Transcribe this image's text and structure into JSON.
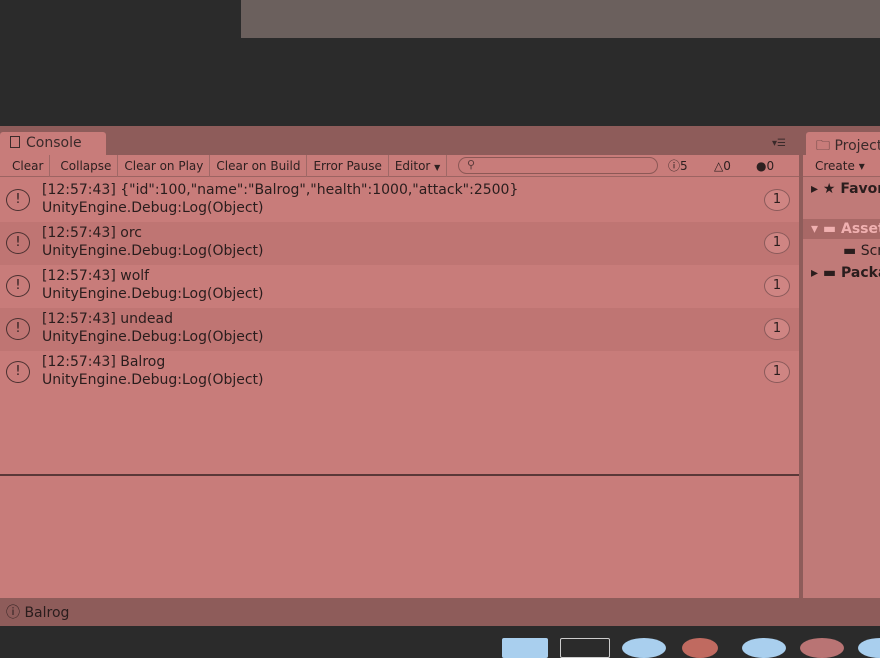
{
  "console": {
    "tab_title": "Console",
    "toolbar": {
      "clear": "Clear",
      "collapse": "Collapse",
      "clear_on_play": "Clear on Play",
      "clear_on_build": "Clear on Build",
      "error_pause": "Error Pause",
      "editor": "Editor"
    },
    "search_placeholder": "",
    "counts": {
      "info": "5",
      "warning": "0",
      "error": "0"
    },
    "entries": [
      {
        "line1": "[12:57:43] {\"id\":100,\"name\":\"Balrog\",\"health\":1000,\"attack\":2500}",
        "line2": "UnityEngine.Debug:Log(Object)",
        "count": "1"
      },
      {
        "line1": "[12:57:43] orc",
        "line2": "UnityEngine.Debug:Log(Object)",
        "count": "1"
      },
      {
        "line1": "[12:57:43] wolf",
        "line2": "UnityEngine.Debug:Log(Object)",
        "count": "1"
      },
      {
        "line1": "[12:57:43] undead",
        "line2": "UnityEngine.Debug:Log(Object)",
        "count": "1"
      },
      {
        "line1": "[12:57:43] Balrog",
        "line2": "UnityEngine.Debug:Log(Object)",
        "count": "1"
      }
    ]
  },
  "project": {
    "tab_title": "Project",
    "create": "Create",
    "items": [
      "Favorites",
      "Assets",
      "Scripts",
      "Packages"
    ]
  },
  "status": {
    "message": "Balrog"
  }
}
